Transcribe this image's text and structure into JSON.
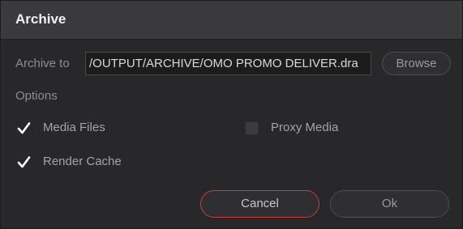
{
  "dialog": {
    "title": "Archive",
    "archive_to_label": "Archive to",
    "archive_path": "/OUTPUT/ARCHIVE/OMO PROMO DELIVER.dra",
    "browse_label": "Browse",
    "options_label": "Options",
    "options": [
      {
        "label": "Media Files",
        "checked": true
      },
      {
        "label": "Proxy Media",
        "checked": false
      },
      {
        "label": "Render Cache",
        "checked": true
      }
    ],
    "cancel_label": "Cancel",
    "ok_label": "Ok"
  },
  "colors": {
    "background": "#28282a",
    "titlebar": "#3a3a3c",
    "accent_cancel_border": "#c73a3a",
    "checkmark": "#ffffff"
  },
  "icons": {
    "checked": "checkmark-icon",
    "unchecked": "empty-checkbox"
  }
}
